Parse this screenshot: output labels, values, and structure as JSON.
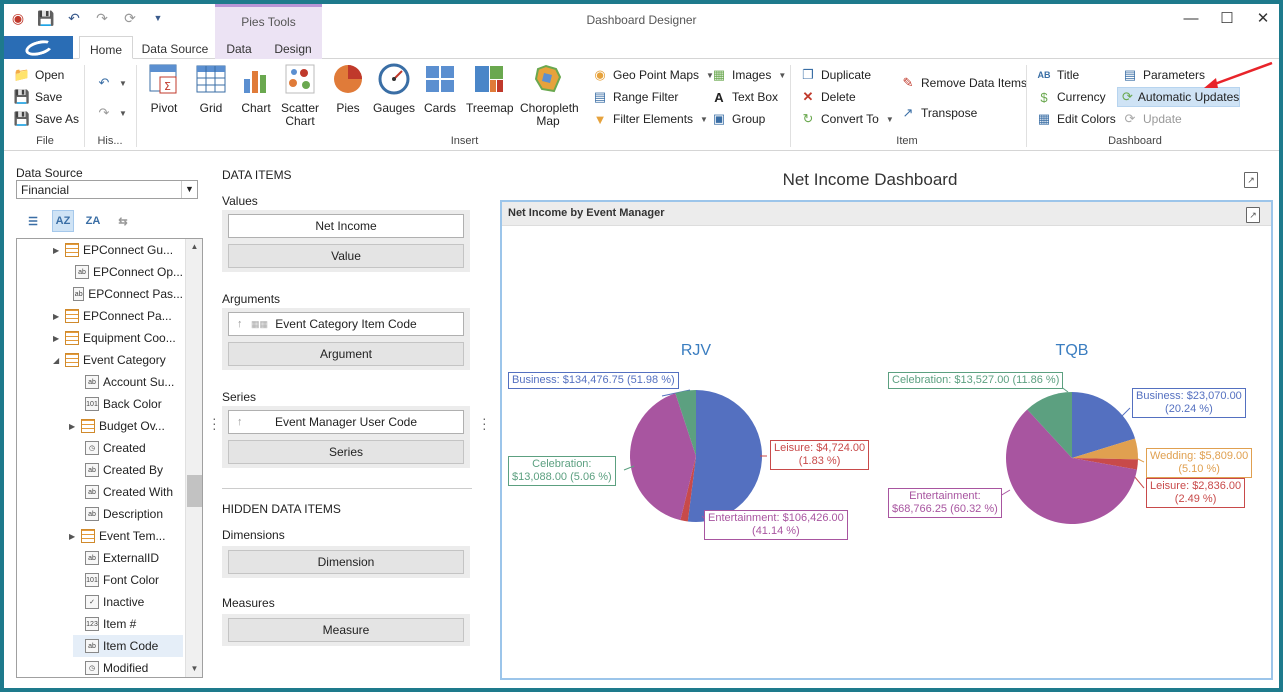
{
  "window": {
    "title": "Dashboard Designer",
    "context_tab": "Pies Tools"
  },
  "tabs": [
    "Home",
    "Data Source",
    "Data",
    "Design"
  ],
  "ribbon": {
    "file": {
      "label": "File",
      "open": "Open",
      "save": "Save",
      "save_as": "Save As"
    },
    "history": {
      "label": "His..."
    },
    "insert": {
      "label": "Insert",
      "pivot": "Pivot",
      "grid": "Grid",
      "chart": "Chart",
      "scatter": "Scatter Chart",
      "pies": "Pies",
      "gauges": "Gauges",
      "cards": "Cards",
      "treemap": "Treemap",
      "choropleth": "Choropleth Map",
      "geo_point_maps": "Geo Point Maps",
      "range_filter": "Range Filter",
      "filter_elements": "Filter Elements",
      "images": "Images",
      "text_box": "Text Box",
      "group": "Group"
    },
    "item": {
      "label": "Item",
      "duplicate": "Duplicate",
      "delete": "Delete",
      "convert_to": "Convert To",
      "remove_data_items": "Remove Data Items",
      "transpose": "Transpose"
    },
    "dashboard": {
      "label": "Dashboard",
      "title": "Title",
      "currency": "Currency",
      "edit_colors": "Edit Colors",
      "parameters": "Parameters",
      "automatic_updates": "Automatic Updates",
      "update": "Update"
    }
  },
  "left_panel": {
    "data_source_label": "Data Source",
    "data_source_value": "Financial",
    "tree": [
      {
        "label": "EPConnect Gu...",
        "icon": "table"
      },
      {
        "label": "EPConnect Op...",
        "icon": "ab"
      },
      {
        "label": "EPConnect Pas...",
        "icon": "ab"
      },
      {
        "label": "EPConnect Pa...",
        "icon": "table"
      },
      {
        "label": "Equipment Coo...",
        "icon": "table"
      },
      {
        "label": "Event Category",
        "icon": "table"
      },
      {
        "label": "Account Su...",
        "icon": "ab"
      },
      {
        "label": "Back Color",
        "icon": "101"
      },
      {
        "label": "Budget Ov...",
        "icon": "table"
      },
      {
        "label": "Created",
        "icon": "clock"
      },
      {
        "label": "Created By",
        "icon": "ab"
      },
      {
        "label": "Created With",
        "icon": "ab"
      },
      {
        "label": "Description",
        "icon": "ab"
      },
      {
        "label": "Event Tem...",
        "icon": "table"
      },
      {
        "label": "ExternalID",
        "icon": "ab"
      },
      {
        "label": "Font Color",
        "icon": "101"
      },
      {
        "label": "Inactive",
        "icon": "check"
      },
      {
        "label": "Item #",
        "icon": "123"
      },
      {
        "label": "Item Code",
        "icon": "ab"
      },
      {
        "label": "Modified",
        "icon": "clock"
      }
    ]
  },
  "data_items": {
    "header": "DATA ITEMS",
    "values_label": "Values",
    "values_item": "Net Income",
    "values_placeholder": "Value",
    "arguments_label": "Arguments",
    "arguments_item": "Event Category Item Code",
    "arguments_placeholder": "Argument",
    "series_label": "Series",
    "series_item": "Event Manager User Code",
    "series_placeholder": "Series",
    "hidden_header": "HIDDEN DATA ITEMS",
    "dimensions_label": "Dimensions",
    "dimensions_placeholder": "Dimension",
    "measures_label": "Measures",
    "measures_placeholder": "Measure"
  },
  "dashboard": {
    "title": "Net Income Dashboard",
    "item_caption": "Net Income by Event Manager"
  },
  "chart_data": {
    "type": "pie",
    "title": "Net Income by Event Manager",
    "pies": [
      {
        "name": "RJV",
        "slices": [
          {
            "category": "Business",
            "value": 134476.75,
            "percent": 51.98,
            "color": "#5470c0",
            "label_line1": "Business: $134,476.75 (51.98 %)",
            "label_line2": ""
          },
          {
            "category": "Leisure",
            "value": 4724.0,
            "percent": 1.83,
            "color": "#c84a4a",
            "label_line1": "Leisure: $4,724.00",
            "label_line2": "(1.83 %)"
          },
          {
            "category": "Entertainment",
            "value": 106426.0,
            "percent": 41.14,
            "color": "#a855a0",
            "label_line1": "Entertainment: $106,426.00",
            "label_line2": "(41.14 %)"
          },
          {
            "category": "Celebration",
            "value": 13088.0,
            "percent": 5.06,
            "color": "#5ca080",
            "label_line1": "Celebration:",
            "label_line2": "$13,088.00 (5.06 %)"
          }
        ]
      },
      {
        "name": "TQB",
        "slices": [
          {
            "category": "Business",
            "value": 23070.0,
            "percent": 20.24,
            "color": "#5470c0",
            "label_line1": "Business: $23,070.00",
            "label_line2": "(20.24 %)"
          },
          {
            "category": "Wedding",
            "value": 5809.0,
            "percent": 5.1,
            "color": "#e0a050",
            "label_line1": "Wedding: $5,809.00",
            "label_line2": "(5.10 %)"
          },
          {
            "category": "Leisure",
            "value": 2836.0,
            "percent": 2.49,
            "color": "#c84a4a",
            "label_line1": "Leisure: $2,836.00",
            "label_line2": "(2.49 %)"
          },
          {
            "category": "Entertainment",
            "value": 68766.25,
            "percent": 60.32,
            "color": "#a855a0",
            "label_line1": "Entertainment:",
            "label_line2": "$68,766.25 (60.32 %)"
          },
          {
            "category": "Celebration",
            "value": 13527.0,
            "percent": 11.86,
            "color": "#5ca080",
            "label_line1": "Celebration: $13,527.00 (11.86 %)",
            "label_line2": ""
          }
        ]
      }
    ]
  }
}
